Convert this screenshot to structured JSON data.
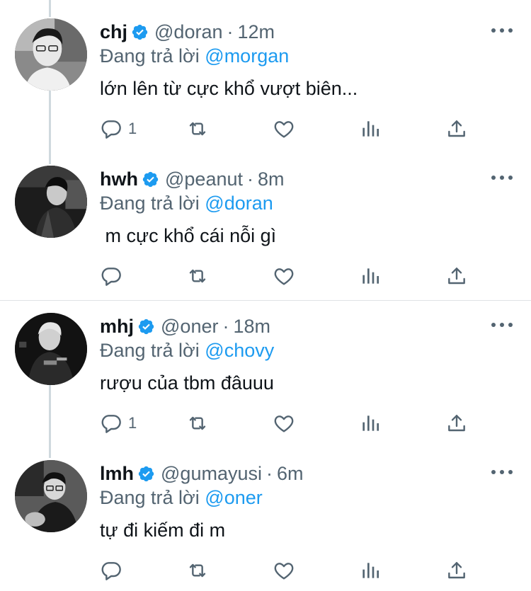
{
  "colors": {
    "accent": "#1d9bf0",
    "secondary": "#536471",
    "text": "#0f1419"
  },
  "tweets": [
    {
      "name": "chj",
      "handle": "@doran",
      "dot": "·",
      "time": "12m",
      "reply_prefix": "Đang trả lời",
      "mention": "@morgan",
      "text": "lớn lên từ cực khổ vượt biên...",
      "reply_count": "1"
    },
    {
      "name": "hwh",
      "handle": "@peanut",
      "dot": "·",
      "time": "8m",
      "reply_prefix": "Đang trả lời",
      "mention": "@doran",
      "text": " m cực khổ cái nỗi gì",
      "reply_count": ""
    },
    {
      "name": "mhj",
      "handle": "@oner",
      "dot": "·",
      "time": "18m",
      "reply_prefix": "Đang trả lời",
      "mention": "@chovy",
      "text": "rượu của tbm đâuuu",
      "reply_count": "1"
    },
    {
      "name": "lmh",
      "handle": "@gumayusi",
      "dot": "·",
      "time": "6m",
      "reply_prefix": "Đang trả lời",
      "mention": "@oner",
      "text": "tự đi kiếm đi m",
      "reply_count": ""
    }
  ],
  "icons": {
    "verified": "verified-badge-icon",
    "reply": "reply-icon",
    "retweet": "retweet-icon",
    "like": "heart-icon",
    "analytics": "analytics-icon",
    "share": "share-icon",
    "more": "more-icon"
  }
}
